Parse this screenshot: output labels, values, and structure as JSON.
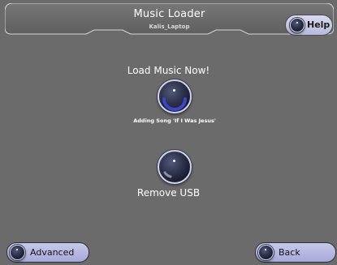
{
  "header": {
    "title": "Music Loader",
    "device": "Kalis_Laptop"
  },
  "help": {
    "label": "Help",
    "icon": "knob-icon"
  },
  "main": {
    "load_label": "Load Music Now!",
    "status_text": "Adding Song 'If I Was Jesus'",
    "remove_label": "Remove USB"
  },
  "footer": {
    "advanced_label": "Advanced",
    "back_label": "Back"
  },
  "colors": {
    "background": "#6b6b6b",
    "button_fill": "#b7b9d9",
    "knob_dark": "#15182a",
    "progress_arc": "#3d46c4"
  }
}
